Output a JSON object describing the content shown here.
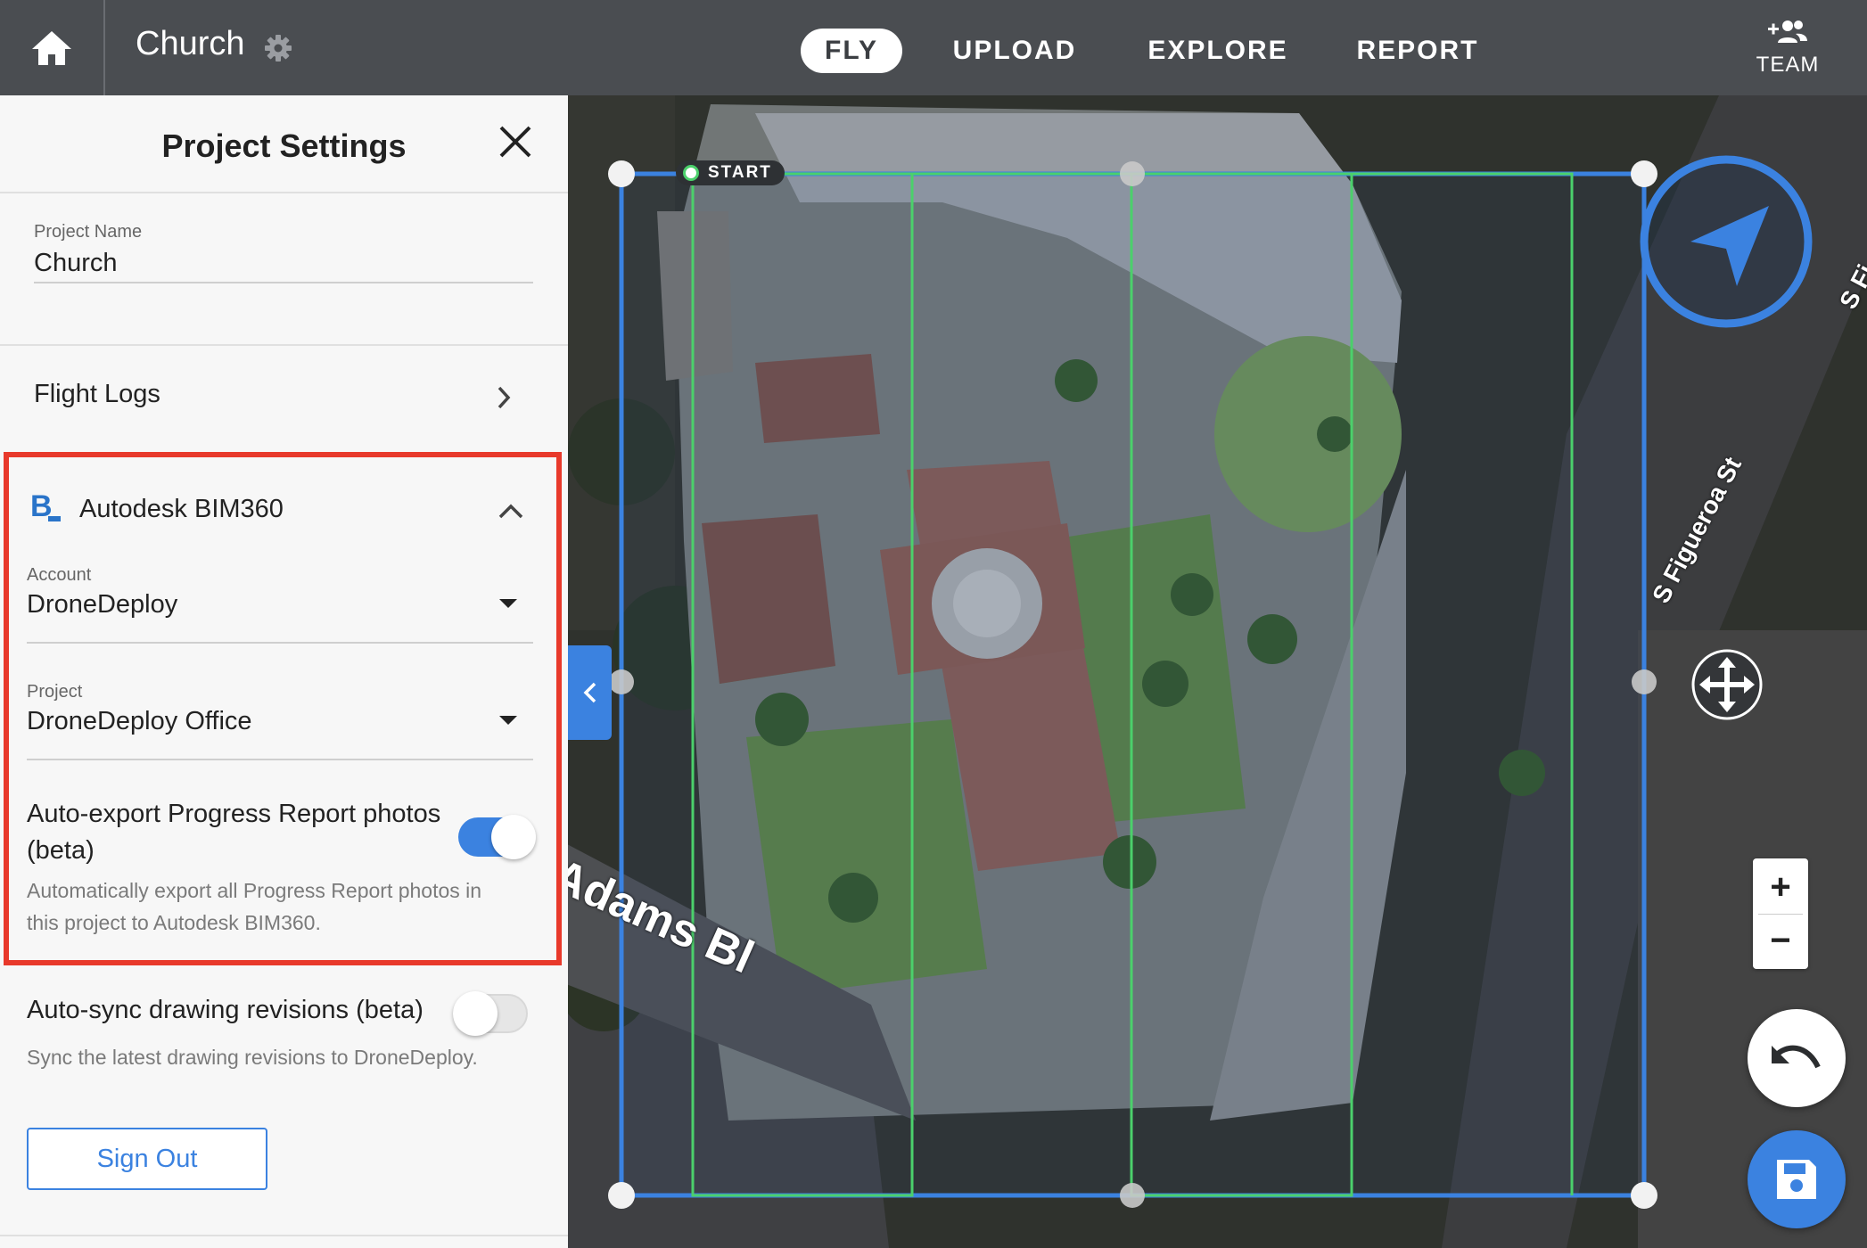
{
  "header": {
    "project_name": "Church",
    "tabs": [
      {
        "label": "FLY",
        "active": true
      },
      {
        "label": "UPLOAD",
        "active": false
      },
      {
        "label": "EXPLORE",
        "active": false
      },
      {
        "label": "REPORT",
        "active": false
      }
    ],
    "team_label": "TEAM"
  },
  "panel": {
    "title": "Project Settings",
    "project_name_label": "Project Name",
    "project_name_value": "Church",
    "flight_logs_label": "Flight Logs",
    "bim360": {
      "title": "Autodesk BIM360",
      "logo_letter": "B",
      "account_label": "Account",
      "account_value": "DroneDeploy",
      "project_label": "Project",
      "project_value": "DroneDeploy Office",
      "auto_export_label_line1": "Auto-export Progress Report photos",
      "auto_export_label_line2": "(beta)",
      "auto_export_on": true,
      "auto_export_help_line1": "Automatically export all Progress Report photos in",
      "auto_export_help_line2": "this project to Autodesk BIM360."
    },
    "auto_sync_label": "Auto-sync drawing revisions (beta)",
    "auto_sync_on": false,
    "auto_sync_help": "Sync the latest drawing revisions to DroneDeploy.",
    "sign_out_label": "Sign Out"
  },
  "map": {
    "start_label": "START",
    "street_adams": "Adams Bl",
    "street_figueroa": "S Figueroa St",
    "street_edge": "S Fi",
    "zoom_in": "+",
    "zoom_out": "−"
  },
  "colors": {
    "topbar": "#4a4d51",
    "accent_blue": "#3b82e0",
    "highlight_red": "#e8392b",
    "flight_line_green": "#4bd06b"
  },
  "icons": [
    "home-icon",
    "gear-icon",
    "add-team-icon",
    "close-icon",
    "chevron-right-icon",
    "chevron-up-icon",
    "caret-down-icon",
    "chevron-left-icon",
    "compass-icon",
    "move-icon",
    "undo-icon",
    "save-icon"
  ]
}
